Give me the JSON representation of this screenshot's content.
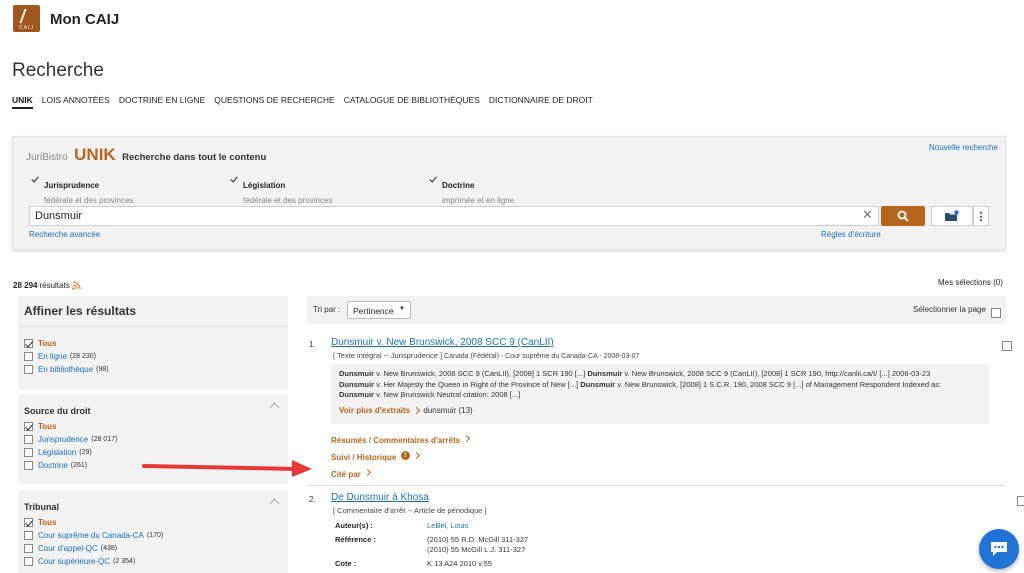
{
  "app": {
    "title": "Mon CAIJ",
    "logo_text": "CAIJ"
  },
  "page": {
    "title": "Recherche"
  },
  "tabs": [
    "UNIK",
    "LOIS ANNOTÉES",
    "DOCTRINE EN LIGNE",
    "QUESTIONS DE RECHERCHE",
    "CATALOGUE DE BIBLIOTHÈQUES",
    "DICTIONNAIRE DE DROIT"
  ],
  "search": {
    "brand": "JuriBistro",
    "unik": "UNIK",
    "subtitle": "Recherche dans tout le contenu",
    "new_search": "Nouvelle recherche",
    "options": [
      {
        "label": "Jurisprudence",
        "sub": "fédérale et des provinces"
      },
      {
        "label": "Législation",
        "sub": "fédérale et des provinces"
      },
      {
        "label": "Doctrine",
        "sub": "imprimée et en ligne"
      }
    ],
    "query": "Dunsmuir",
    "advanced": "Recherche avancée",
    "rules": "Règles d'écriture"
  },
  "results": {
    "count": "28 294",
    "count_label": "résultats",
    "my_selections": "Mes sélections (0)"
  },
  "refine": {
    "title": "Affiner les résultats",
    "groups": [
      {
        "items": [
          {
            "label": "Tous",
            "count": ""
          },
          {
            "label": "En ligne",
            "count": "(28 230)"
          },
          {
            "label": "En bibliothèque",
            "count": "(98)"
          }
        ]
      },
      {
        "title": "Source du droit",
        "items": [
          {
            "label": "Tous",
            "count": ""
          },
          {
            "label": "Jurisprudence",
            "count": "(28 017)"
          },
          {
            "label": "Législation",
            "count": "(29)"
          },
          {
            "label": "Doctrine",
            "count": "(261)"
          }
        ]
      },
      {
        "title": "Tribunal",
        "items": [
          {
            "label": "Tous",
            "count": ""
          },
          {
            "label": "Cour suprême du Canada-CA",
            "count": "(170)"
          },
          {
            "label": "Cour d'appel-QC",
            "count": "(438)"
          },
          {
            "label": "Cour supérieure-QC",
            "count": "(2 354)"
          }
        ]
      }
    ]
  },
  "toolbar": {
    "sort_label": "Tri par :",
    "sort_value": "Pertinence",
    "select_page": "Sélectionner la page"
  },
  "items": [
    {
      "num": "1.",
      "title": "Dunsmuir v. New Brunswick, 2008 SCC 9 (CanLII)",
      "meta_type": "[ Texte intégral -- Jurisprudence ]",
      "meta_court": "Canada (Fédéral) - Cour suprême du Canada-CA - 2008-03-07",
      "excerpt_lines": [
        [
          {
            "b": "Dunsmuir"
          },
          {
            "t": " v. New Brunswick, 2008 SCC 9 (CanLII), [2008] 1 SCR 190 [...] "
          },
          {
            "b": "Dunsmuir"
          },
          {
            "t": " v. New Brunswick, 2008 SCC 9 (CanLII), [2008] 1 SCR 190, http://canlii.ca/t/ [...] 2006-03-23"
          }
        ],
        [
          {
            "b": "Dunsmuir"
          },
          {
            "t": " v. Her Majesty the Queen in Right of the Province of New [...] "
          },
          {
            "b": "Dunsmuir"
          },
          {
            "t": " v. New Brunswick, [2008] 1 S.C.R. 190, 2008 SCC 9 [...] of Management Respondent Indexed as:"
          }
        ],
        [
          {
            "b": "Dunsmuir"
          },
          {
            "t": " v. New Brunswick Neutral citation: 2008 [...]"
          }
        ]
      ],
      "more_extracts": "Voir plus d'extraits",
      "more_term": "dunsmuir (13)",
      "links": [
        "Résumés / Commentaires d'arrêts",
        "Suivi / Historique",
        "Cité par"
      ]
    },
    {
      "num": "2.",
      "title": "De Dunsmuir à Khosa",
      "meta_type": "[ Commentaire d'arrêt -- Article de périodique ]",
      "details": [
        {
          "label": "Auteur(s) :",
          "values": [
            "LeBel, Louis"
          ],
          "link": true
        },
        {
          "label": "Référence :",
          "values": [
            "(2010) 55 R.D. McGill 311-327",
            "(2010) 55 McGill L.J. 311-327"
          ]
        },
        {
          "label": "Cote :",
          "values": [
            "K 13 A24 2010 v.55"
          ]
        }
      ]
    }
  ],
  "colors": {
    "brand": "#b5651d",
    "link": "#1a6fb8",
    "arrow": "#e53935",
    "chat": "#1f74d6"
  }
}
